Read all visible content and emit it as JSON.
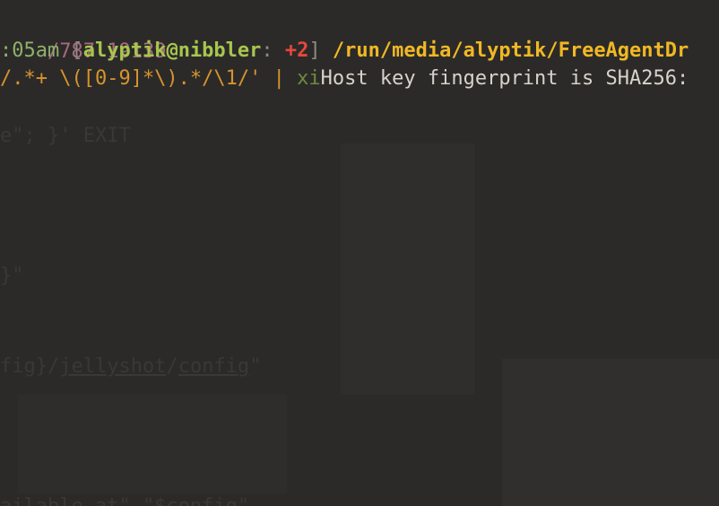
{
  "terminal": {
    "line1": {
      "text": "/787 19139"
    },
    "line2": {
      "time": ":05am",
      "open_bracket": " [",
      "user_host": "alyptik@nibbler",
      "colon": ": ",
      "jobs": "+2",
      "close_bracket": "] ",
      "path": "/run/media/alyptik/FreeAgentDr"
    },
    "line3": {
      "sed_expr": "/.*+ \\([0-9]*\\).*/\\1/' | ",
      "xi": "xi",
      "message": "Host key fingerprint is SHA256:"
    }
  },
  "background_editor": {
    "lines": [
      "e\"; }' EXIT",
      "}\"",
      "fig}/jellyshot/config\"",
      "ailable.at\" \"$config\""
    ],
    "underlined": [
      "jellyshot",
      "config"
    ]
  },
  "colors": {
    "background": "#2b2a29",
    "prompt_user": "#a7c64d",
    "prompt_jobs": "#e8473b",
    "prompt_path": "#f0b824",
    "pid_line": "#a8697d",
    "sed_expression": "#d8932e",
    "output_text": "#d7d3cb"
  }
}
